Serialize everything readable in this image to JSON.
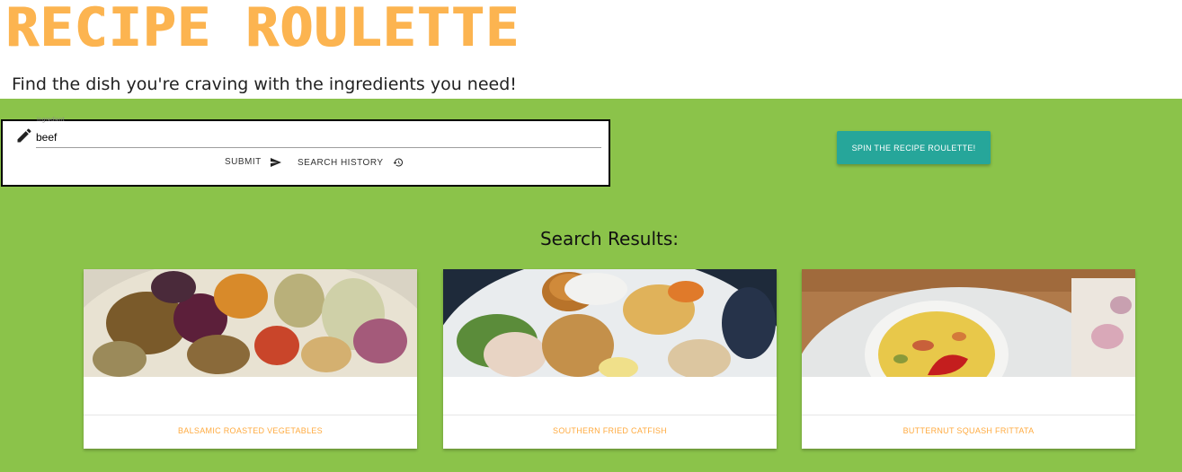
{
  "header": {
    "title": "RECIPE ROULETTE",
    "tagline": "Find the dish you're craving with the ingredients you need!"
  },
  "search": {
    "field_label": "Ingredient",
    "value": "beef",
    "submit_label": "SUBMIT",
    "submit_icon": "send-icon",
    "history_label": "SEARCH HISTORY",
    "history_icon": "history-icon",
    "edit_icon": "pencil-icon"
  },
  "spin_button": {
    "label": "SPIN THE RECIPE ROULETTE!"
  },
  "results": {
    "heading": "Search Results:",
    "cards": [
      {
        "title": "BALSAMIC ROASTED VEGETABLES"
      },
      {
        "title": "SOUTHERN FRIED CATFISH"
      },
      {
        "title": "BUTTERNUT SQUASH FRITTATA"
      }
    ]
  },
  "colors": {
    "title": "#fcb450",
    "background": "#8bc34a",
    "spin_button": "#26a69a",
    "card_title": "#ffab40"
  }
}
